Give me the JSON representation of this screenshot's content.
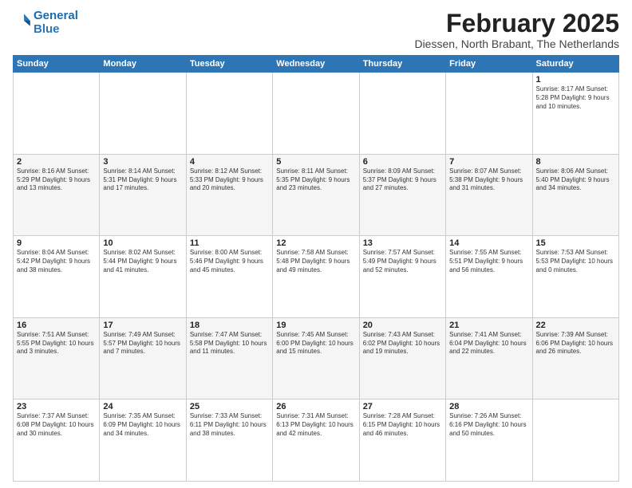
{
  "logo": {
    "line1": "General",
    "line2": "Blue"
  },
  "title": "February 2025",
  "subtitle": "Diessen, North Brabant, The Netherlands",
  "weekdays": [
    "Sunday",
    "Monday",
    "Tuesday",
    "Wednesday",
    "Thursday",
    "Friday",
    "Saturday"
  ],
  "weeks": [
    [
      {
        "day": "",
        "info": ""
      },
      {
        "day": "",
        "info": ""
      },
      {
        "day": "",
        "info": ""
      },
      {
        "day": "",
        "info": ""
      },
      {
        "day": "",
        "info": ""
      },
      {
        "day": "",
        "info": ""
      },
      {
        "day": "1",
        "info": "Sunrise: 8:17 AM\nSunset: 5:28 PM\nDaylight: 9 hours and 10 minutes."
      }
    ],
    [
      {
        "day": "2",
        "info": "Sunrise: 8:16 AM\nSunset: 5:29 PM\nDaylight: 9 hours and 13 minutes."
      },
      {
        "day": "3",
        "info": "Sunrise: 8:14 AM\nSunset: 5:31 PM\nDaylight: 9 hours and 17 minutes."
      },
      {
        "day": "4",
        "info": "Sunrise: 8:12 AM\nSunset: 5:33 PM\nDaylight: 9 hours and 20 minutes."
      },
      {
        "day": "5",
        "info": "Sunrise: 8:11 AM\nSunset: 5:35 PM\nDaylight: 9 hours and 23 minutes."
      },
      {
        "day": "6",
        "info": "Sunrise: 8:09 AM\nSunset: 5:37 PM\nDaylight: 9 hours and 27 minutes."
      },
      {
        "day": "7",
        "info": "Sunrise: 8:07 AM\nSunset: 5:38 PM\nDaylight: 9 hours and 31 minutes."
      },
      {
        "day": "8",
        "info": "Sunrise: 8:06 AM\nSunset: 5:40 PM\nDaylight: 9 hours and 34 minutes."
      }
    ],
    [
      {
        "day": "9",
        "info": "Sunrise: 8:04 AM\nSunset: 5:42 PM\nDaylight: 9 hours and 38 minutes."
      },
      {
        "day": "10",
        "info": "Sunrise: 8:02 AM\nSunset: 5:44 PM\nDaylight: 9 hours and 41 minutes."
      },
      {
        "day": "11",
        "info": "Sunrise: 8:00 AM\nSunset: 5:46 PM\nDaylight: 9 hours and 45 minutes."
      },
      {
        "day": "12",
        "info": "Sunrise: 7:58 AM\nSunset: 5:48 PM\nDaylight: 9 hours and 49 minutes."
      },
      {
        "day": "13",
        "info": "Sunrise: 7:57 AM\nSunset: 5:49 PM\nDaylight: 9 hours and 52 minutes."
      },
      {
        "day": "14",
        "info": "Sunrise: 7:55 AM\nSunset: 5:51 PM\nDaylight: 9 hours and 56 minutes."
      },
      {
        "day": "15",
        "info": "Sunrise: 7:53 AM\nSunset: 5:53 PM\nDaylight: 10 hours and 0 minutes."
      }
    ],
    [
      {
        "day": "16",
        "info": "Sunrise: 7:51 AM\nSunset: 5:55 PM\nDaylight: 10 hours and 3 minutes."
      },
      {
        "day": "17",
        "info": "Sunrise: 7:49 AM\nSunset: 5:57 PM\nDaylight: 10 hours and 7 minutes."
      },
      {
        "day": "18",
        "info": "Sunrise: 7:47 AM\nSunset: 5:58 PM\nDaylight: 10 hours and 11 minutes."
      },
      {
        "day": "19",
        "info": "Sunrise: 7:45 AM\nSunset: 6:00 PM\nDaylight: 10 hours and 15 minutes."
      },
      {
        "day": "20",
        "info": "Sunrise: 7:43 AM\nSunset: 6:02 PM\nDaylight: 10 hours and 19 minutes."
      },
      {
        "day": "21",
        "info": "Sunrise: 7:41 AM\nSunset: 6:04 PM\nDaylight: 10 hours and 22 minutes."
      },
      {
        "day": "22",
        "info": "Sunrise: 7:39 AM\nSunset: 6:06 PM\nDaylight: 10 hours and 26 minutes."
      }
    ],
    [
      {
        "day": "23",
        "info": "Sunrise: 7:37 AM\nSunset: 6:08 PM\nDaylight: 10 hours and 30 minutes."
      },
      {
        "day": "24",
        "info": "Sunrise: 7:35 AM\nSunset: 6:09 PM\nDaylight: 10 hours and 34 minutes."
      },
      {
        "day": "25",
        "info": "Sunrise: 7:33 AM\nSunset: 6:11 PM\nDaylight: 10 hours and 38 minutes."
      },
      {
        "day": "26",
        "info": "Sunrise: 7:31 AM\nSunset: 6:13 PM\nDaylight: 10 hours and 42 minutes."
      },
      {
        "day": "27",
        "info": "Sunrise: 7:28 AM\nSunset: 6:15 PM\nDaylight: 10 hours and 46 minutes."
      },
      {
        "day": "28",
        "info": "Sunrise: 7:26 AM\nSunset: 6:16 PM\nDaylight: 10 hours and 50 minutes."
      },
      {
        "day": "",
        "info": ""
      }
    ]
  ]
}
